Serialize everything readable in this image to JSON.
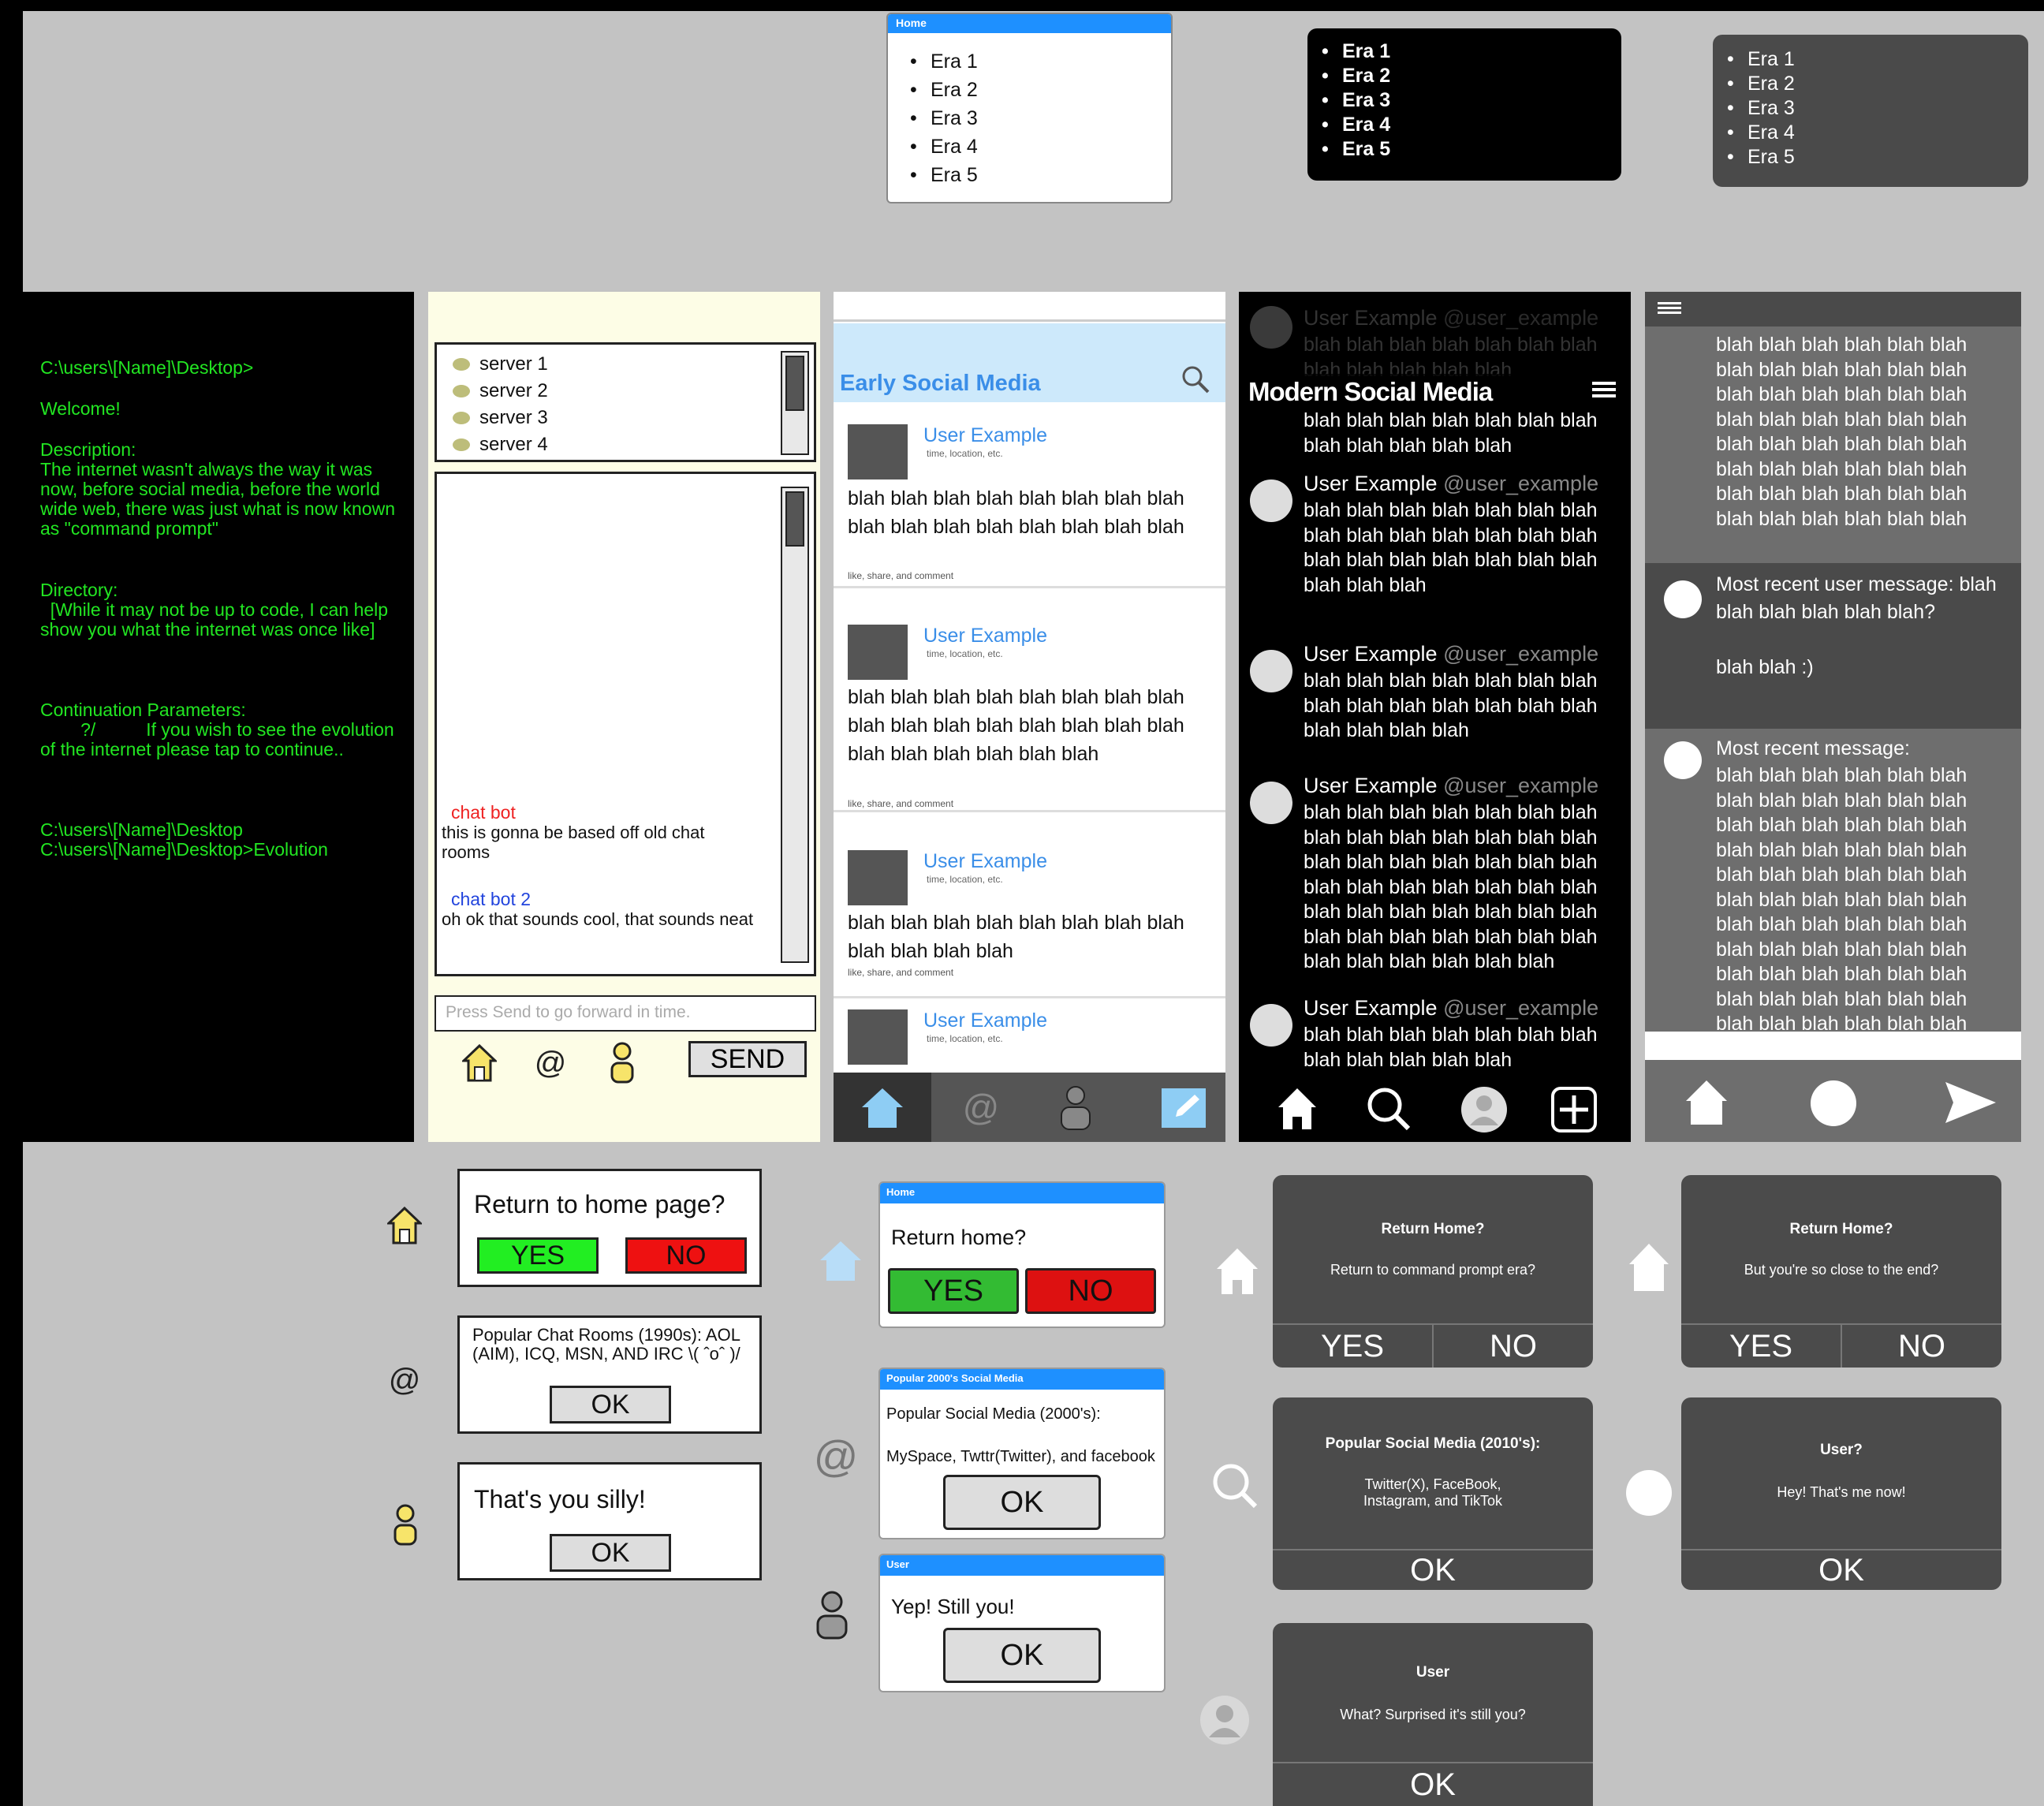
{
  "eras": {
    "items": [
      "Era 1",
      "Era 2",
      "Era 3",
      "Era 4",
      "Era 5"
    ],
    "white_header": "Home"
  },
  "terminal": {
    "prompt1": "C:\\users\\[Name]\\Desktop>",
    "welcome": "Welcome!",
    "desc_label": "Description:",
    "desc_text": "The internet wasn't always the way it was now, before social media, before the world wide web, there was just what is now known as \"command prompt\"",
    "dir_label": "Directory:",
    "dir_text": "  [While it may not be up to code, I can help show you what the internet was once like]",
    "cont_label": "Continuation Parameters:",
    "cont_text": "        ?/          If you wish to see the evolution of the internet please tap to continue..",
    "cmd1": "C:\\users\\[Name]\\Desktop",
    "cmd2": "C:\\users\\[Name]\\Desktop>Evolution",
    "text_color": "#22e622"
  },
  "chat": {
    "servers": [
      "server 1",
      "server 2",
      "server 3",
      "server 4"
    ],
    "msg1_name": "chat bot",
    "msg1_text": "this is gonna be based off old chat rooms",
    "msg2_name": "chat bot 2",
    "msg2_text": "oh ok that sounds cool, that sounds neat",
    "input_placeholder": "Press Send to go forward in time.",
    "send_label": "SEND",
    "icons": [
      "home-icon",
      "at-icon",
      "user-icon"
    ]
  },
  "early": {
    "title": "Early Social Media",
    "posts": [
      {
        "user": "User Example",
        "meta": "time, location, etc.",
        "body": "blah blah blah blah blah blah blah blah blah blah blah blah blah blah blah blah",
        "actions": "like, share, and comment"
      },
      {
        "user": "User Example",
        "meta": "time, location, etc.",
        "body": "blah blah blah blah blah blah blah blah blah blah blah blah blah blah blah blah blah blah blah blah blah blah",
        "actions": "like, share, and comment"
      },
      {
        "user": "User Example",
        "meta": "time, location, etc.",
        "body": "blah blah blah blah blah blah blah blah blah blah blah blah",
        "actions": "like, share, and comment"
      },
      {
        "user": "User Example",
        "meta": "time, location, etc.",
        "body": "",
        "actions": ""
      }
    ],
    "accent": "#3a8ee8",
    "header_bg": "#cde9fb"
  },
  "modern": {
    "title": "Modern Social Media",
    "faded_user": "User Example",
    "faded_handle": "@user_example",
    "top_text": "blah blah blah blah blah blah blah blah blah blah blah blah",
    "posts": [
      {
        "user": "User Example",
        "handle": "@user_example",
        "body": "blah blah blah blah blah blah blah blah blah blah blah blah blah blah blah blah blah blah blah blah blah blah blah blah"
      },
      {
        "user": "User Example",
        "handle": "@user_example",
        "body": "blah blah blah blah blah blah blah blah blah blah blah blah blah blah blah blah blah blah"
      },
      {
        "user": "User Example",
        "handle": "@user_example",
        "body": "blah blah blah blah blah blah blah blah blah blah blah blah blah blah blah blah blah blah blah blah blah blah blah blah blah blah blah blah blah blah blah blah blah blah blah blah blah blah blah blah blah blah blah blah blah blah blah blah"
      },
      {
        "user": "User Example",
        "handle": "@user_example",
        "body": "blah blah blah blah blah blah blah blah blah blah blah blah"
      }
    ]
  },
  "messages": {
    "top_text": "blah blah blah blah blah blah blah blah blah blah blah blah blah blah blah blah blah blah blah blah blah blah blah blah blah blah blah blah blah blah blah blah blah blah blah blah blah blah blah blah blah blah blah blah blah blah blah blah",
    "user_msg": "Most recent user message: blah blah blah blah blah blah?\n\nblah blah :)",
    "recent_label": "Most recent message:",
    "recent_text": "blah blah blah blah blah blah blah blah blah blah blah blah blah blah blah blah blah blah blah blah blah blah blah blah blah blah blah blah blah blah blah blah blah blah blah blah blah blah blah blah blah blah blah blah blah blah blah blah blah blah blah blah blah blah blah blah blah blah blah blah blah blah blah blah blah blah blah blah blah blah blah blah blah blah blah blah blah blah blah blah blah blah blah blah blah blah blah blah blah blah"
  },
  "dialogs": {
    "y_home_q": "Return to home page?",
    "y_yes": "YES",
    "y_no": "NO",
    "y_popular": "Popular Chat Rooms (1990s): AOL (AIM), ICQ, MSN, AND IRC \\( ˆoˆ )/",
    "y_ok": "OK",
    "y_user": "That's you silly!",
    "b_home_bar": "Home",
    "b_home_q": "Return home?",
    "b_yes": "YES",
    "b_no": "NO",
    "b_pop_bar": "Popular 2000's Social Media",
    "b_pop_title": "Popular Social Media (2000's):",
    "b_pop_text": "MySpace, Twttr(Twitter), and facebook",
    "b_ok": "OK",
    "b_user_bar": "User",
    "b_user_text": "Yep! Still you!",
    "d1_home_title": "Return Home?",
    "d1_home_text": "Return to command prompt era?",
    "d_yes": "YES",
    "d_no": "NO",
    "d1_pop_title": "Popular Social Media (2010's):",
    "d1_pop_text": "Twitter(X), FaceBook, Instagram, and TikTok",
    "d_ok": "OK",
    "d1_user_title": "User",
    "d1_user_text": "What? Surprised it's still you?",
    "d2_home_title": "Return Home?",
    "d2_home_text": "But you're so close to the end?",
    "d2_user_title": "User?",
    "d2_user_text": "Hey! That's me now!"
  },
  "colors": {
    "background": "#c3c3c3",
    "yes_green": "#22ee22",
    "no_red": "#ee1111",
    "blue_bar": "#1e90ff",
    "dark_dialog": "#4b4b4b"
  }
}
